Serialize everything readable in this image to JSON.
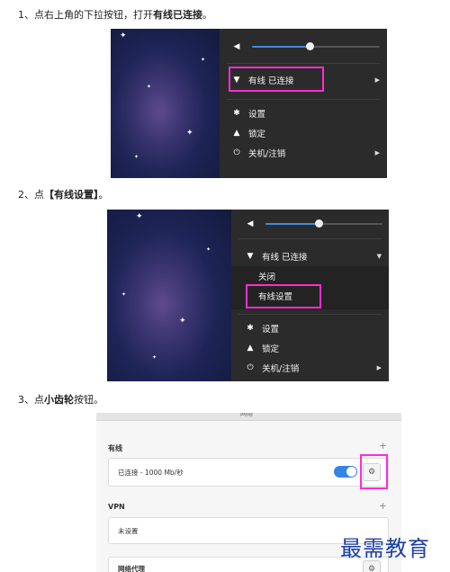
{
  "step1": {
    "pre": "1、点右上角的下拉按钮，打开",
    "bold": "有线已连接",
    "post": "。"
  },
  "step2": {
    "pre": "2、点",
    "bold": "【有线设置】",
    "post": "。"
  },
  "step3": {
    "pre": "3、点",
    "bold": "小齿轮",
    "post": "按钮。"
  },
  "menu1": {
    "wired": "有线 已连接",
    "settings": "设置",
    "lock": "锁定",
    "power": "关机/注销"
  },
  "menu2": {
    "wired": "有线 已连接",
    "off": "关闭",
    "wired_settings": "有线设置",
    "settings": "设置",
    "lock": "锁定",
    "power": "关机/注销"
  },
  "volume_level": 0.45,
  "network_panel": {
    "header_fragment": "网络",
    "wired_section": "有线",
    "wired_status": "已连接 - 1000 Mb/秒",
    "vpn_section": "VPN",
    "vpn_status": "未设置",
    "proxy_label": "网络代理",
    "plus": "+"
  },
  "watermark": "最需教育",
  "colors": {
    "highlight": "#ff2bd6",
    "accent": "#3584e4",
    "menu_bg": "#2b2b2b",
    "watermark": "#1b3fa6"
  },
  "icons": [
    "volume-icon",
    "network-wired-icon",
    "gear-icon",
    "lock-icon",
    "power-icon",
    "chevron-right-icon"
  ]
}
